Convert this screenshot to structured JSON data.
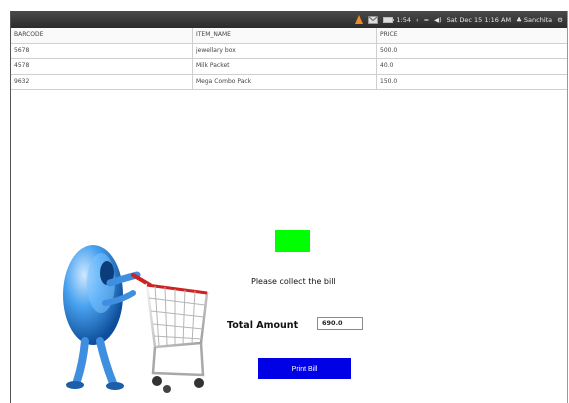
{
  "system_tray": {
    "mail_count": "",
    "battery": "1:54",
    "datetime": "Sat Dec 15  1:16 AM",
    "user": "Sanchita"
  },
  "table": {
    "headers": [
      "BARCODE",
      "ITEM_NAME",
      "PRICE"
    ],
    "rows": [
      [
        "5678",
        "jewellary box",
        "500.0"
      ],
      [
        "4578",
        "Milk Packet",
        "40.0"
      ],
      [
        "9632",
        "Mega Combo Pack",
        "150.0"
      ]
    ]
  },
  "status": {
    "message": "Please collect the bill",
    "indicator_color": "#00ff00"
  },
  "total": {
    "label": "Total Amount",
    "value": "690.0"
  },
  "print_button": {
    "label": "Print Bill",
    "color": "#0000e6"
  },
  "illustration": {
    "icon": "shopping-cart-mascot"
  }
}
